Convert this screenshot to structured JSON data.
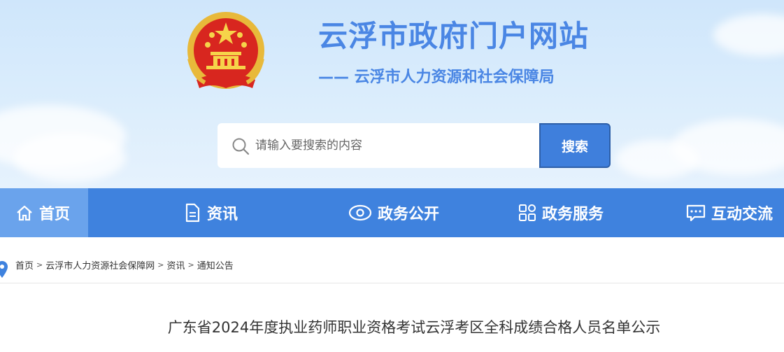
{
  "header": {
    "site_title": "云浮市政府门户网站",
    "site_subtitle": "—— 云浮市人力资源和社会保障局"
  },
  "search": {
    "placeholder": "请输入要搜索的内容",
    "button_label": "搜索"
  },
  "nav": {
    "items": [
      {
        "label": "首页",
        "icon": "home-icon"
      },
      {
        "label": "资讯",
        "icon": "document-icon"
      },
      {
        "label": "政务公开",
        "icon": "eye-icon"
      },
      {
        "label": "政务服务",
        "icon": "grid-icon"
      },
      {
        "label": "互动交流",
        "icon": "chat-icon"
      }
    ],
    "active": "首页"
  },
  "breadcrumb": {
    "items": [
      "首页",
      "云浮市人力资源社会保障网",
      "资讯",
      "通知公告"
    ],
    "separator": ">"
  },
  "article": {
    "title": "广东省2024年度执业药师职业资格考试云浮考区全科成绩合格人员名单公示"
  },
  "colors": {
    "brand": "#4a86e4",
    "nav_bg": "#3f82de",
    "nav_active": "#6aa3ec",
    "search_button": "#3f7fdc"
  }
}
